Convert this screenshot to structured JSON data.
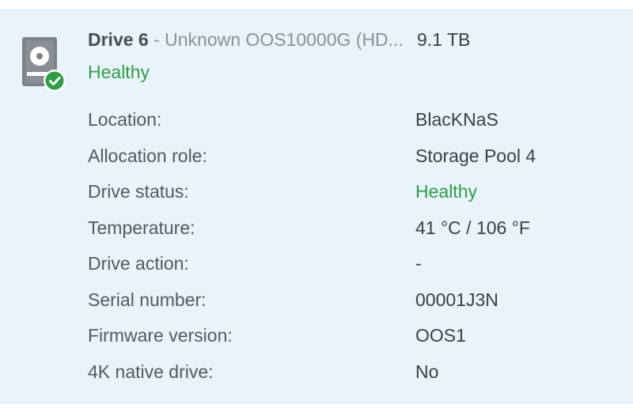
{
  "drive": {
    "name": "Drive 6",
    "model": " - Unknown OOS10000G (HD...",
    "capacity": "9.1 TB",
    "status": "Healthy",
    "icon": "hard-drive-healthy-icon",
    "status_color": "#2ea043"
  },
  "details": [
    {
      "label": "Location:",
      "value": "BlacKNaS"
    },
    {
      "label": "Allocation role:",
      "value": "Storage Pool 4"
    },
    {
      "label": "Drive status:",
      "value": "Healthy"
    },
    {
      "label": "Temperature:",
      "value": "41 °C / 106 °F"
    },
    {
      "label": "Drive action:",
      "value": "-"
    },
    {
      "label": "Serial number:",
      "value": "00001J3N"
    },
    {
      "label": "Firmware version:",
      "value": "OOS1"
    },
    {
      "label": "4K native drive:",
      "value": "No"
    }
  ]
}
